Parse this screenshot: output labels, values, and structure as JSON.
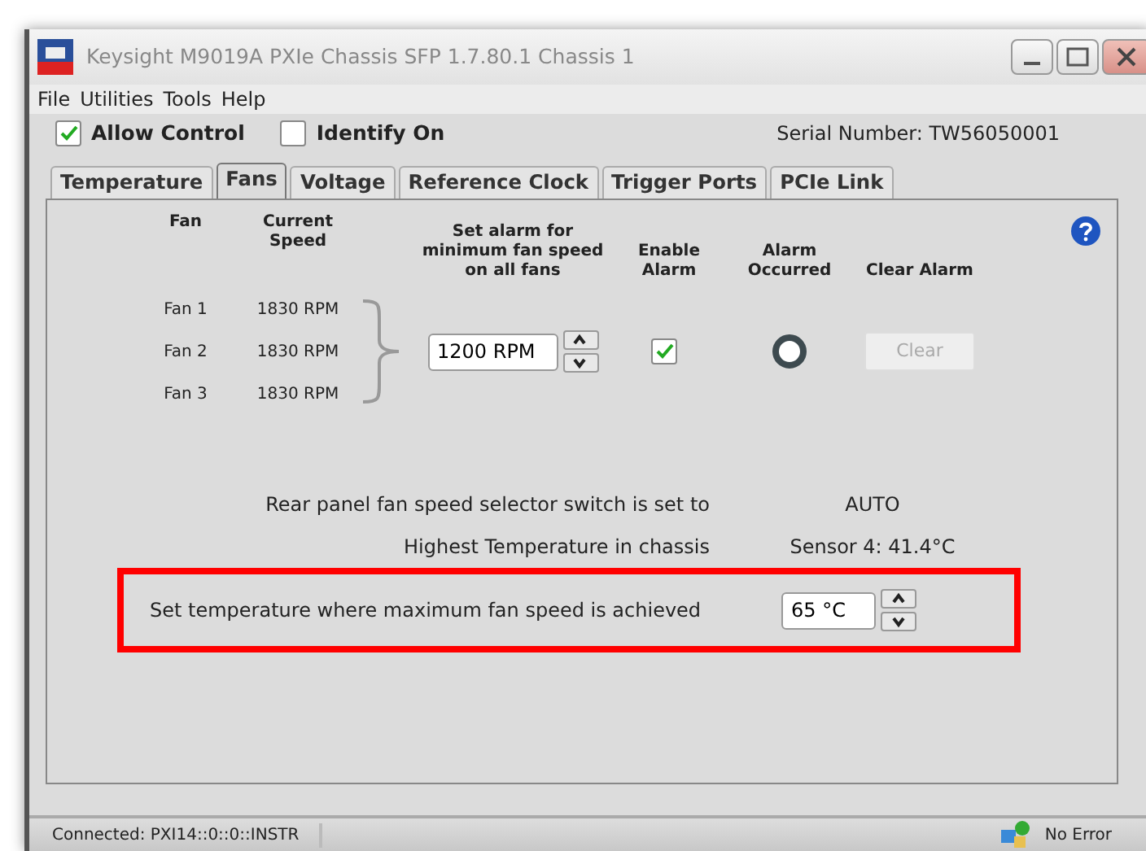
{
  "window": {
    "title": "Keysight M9019A PXIe Chassis SFP 1.7.80.1 Chassis 1"
  },
  "menu": [
    "File",
    "Utilities",
    "Tools",
    "Help"
  ],
  "options": [
    {
      "label": "Allow Control",
      "checked": true
    },
    {
      "label": "Identify On",
      "checked": false
    }
  ],
  "serial_number": "Serial Number: TW56050001",
  "tabs": [
    {
      "label": "Temperature",
      "selected": false
    },
    {
      "label": "Fans",
      "selected": true
    },
    {
      "label": "Voltage",
      "selected": false
    },
    {
      "label": "Reference Clock",
      "selected": false
    },
    {
      "label": "Trigger Ports",
      "selected": false
    },
    {
      "label": "PCIe Link",
      "selected": false
    }
  ],
  "fans": {
    "columns": [
      "Fan",
      "Current Speed"
    ],
    "rows": [
      {
        "name": "Fan 1",
        "speed": "1830 RPM"
      },
      {
        "name": "Fan 2",
        "speed": "1830 RPM"
      },
      {
        "name": "Fan 3",
        "speed": "1830 RPM"
      }
    ],
    "alarm_threshold": {
      "label": "Set alarm for minimum fan speed on all fans",
      "value": "1200 RPM"
    },
    "enable_alarm": {
      "label": "Enable Alarm",
      "checked": true
    },
    "alarm_occurred": {
      "label": "Alarm Occurred",
      "on": false
    },
    "clear_alarm": {
      "label": "Clear Alarm",
      "button": "Clear",
      "disabled": true
    }
  },
  "info": [
    {
      "label": "Rear panel fan speed selector switch is set to",
      "value": "AUTO"
    },
    {
      "label": "Highest Temperature in chassis",
      "value": "Sensor 4: 41.4°C"
    }
  ],
  "max_fan_temperature": {
    "label": "Set temperature where maximum fan speed is achieved",
    "value": "65 °C",
    "highlighted": true
  },
  "status_bar": {
    "connection": "Connected: PXI14::0::0::INSTR",
    "error": "No Error"
  }
}
